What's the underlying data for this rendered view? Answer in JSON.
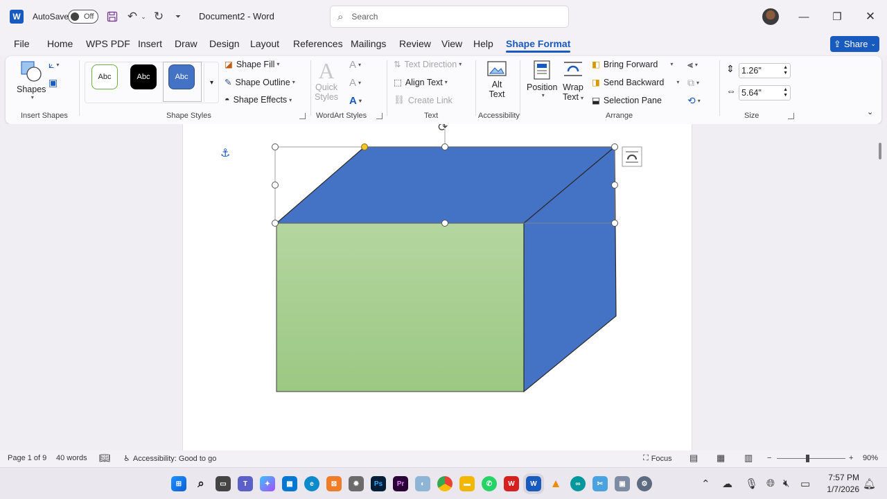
{
  "titlebar": {
    "app_logo": "W",
    "autosave_label": "AutoSave",
    "autosave_state": "Off",
    "doc_title": "Document2  -  Word",
    "search_placeholder": "Search",
    "icons": [
      "save-icon",
      "undo-icon",
      "redo-icon",
      "customize-qat-icon",
      "minimize-icon",
      "restore-icon",
      "close-icon"
    ]
  },
  "tabs": [
    "File",
    "Home",
    "WPS PDF",
    "Insert",
    "Draw",
    "Design",
    "Layout",
    "References",
    "Mailings",
    "Review",
    "View",
    "Help",
    "Shape Format"
  ],
  "active_tab": "Shape Format",
  "share_label": "Share",
  "ribbon": {
    "insert_shapes": {
      "shapes_label": "Shapes",
      "group_label": "Insert Shapes"
    },
    "shape_styles": {
      "samples": [
        "Abc",
        "Abc",
        "Abc"
      ],
      "fill": "Shape Fill",
      "outline": "Shape Outline",
      "effects": "Shape Effects",
      "group_label": "Shape Styles"
    },
    "wordart": {
      "quick_styles_1": "Quick",
      "quick_styles_2": "Styles",
      "group_label": "WordArt Styles"
    },
    "text": {
      "direction": "Text Direction",
      "align": "Align Text",
      "link": "Create Link",
      "group_label": "Text"
    },
    "accessibility": {
      "alt_1": "Alt",
      "alt_2": "Text",
      "group_label": "Accessibility"
    },
    "arrange": {
      "position": "Position",
      "wrap_1": "Wrap",
      "wrap_2": "Text",
      "bring_forward": "Bring Forward",
      "send_backward": "Send Backward",
      "selection_pane": "Selection Pane",
      "group_label": "Arrange"
    },
    "size": {
      "height": "1.26\"",
      "width": "5.64\"",
      "group_label": "Size"
    }
  },
  "shape": {
    "front_color": "#a5cd8e",
    "top_color": "#4472c4",
    "side_color": "#4472c4"
  },
  "statusbar": {
    "page": "Page 1 of 9",
    "words": "40 words",
    "accessibility": "Accessibility: Good to go",
    "focus": "Focus",
    "zoom": "90%"
  },
  "taskbar": {
    "time": "7:57 PM",
    "date": "1/7/2026"
  },
  "colors": {
    "accent": "#185abd"
  }
}
